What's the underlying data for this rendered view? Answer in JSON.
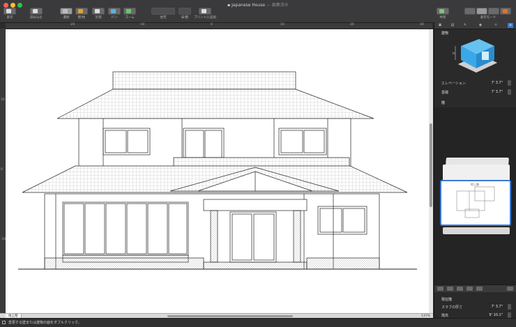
{
  "window": {
    "title": "Japanese House",
    "subtitle": "— 編集済み"
  },
  "toolbar": {
    "view_label": "表示",
    "import_label": "読み込む",
    "select_label": "選択",
    "wall_label": "壁/柱",
    "measure_label": "計測",
    "pan_label": "パン",
    "zoom_label": "ズーム",
    "home_label": "住宅",
    "floor_label": "床/壁",
    "print_label": "プリントに追加",
    "share_label": "共有",
    "display_mode_label": "表示モード"
  },
  "ruler": {
    "top_ticks": [
      "-20",
      "-10",
      "0",
      "10",
      "20",
      "30"
    ],
    "left_ticks": [
      "10",
      "0",
      "-10"
    ]
  },
  "canvas": {
    "layer_tab": "地上階",
    "zoom": "137%"
  },
  "status": {
    "message": "変更する壁または建物の面をダブルクリック。"
  },
  "panel": {
    "building_heading": "建物",
    "elevation_label": "エレベーション",
    "elevation_value": "7' 3.7\"",
    "foundation_label": "基礎",
    "foundation_value": "7' 3.7\"",
    "floor_heading": "階",
    "floor_card_label": "地上階",
    "current_floor_heading": "現在階",
    "slab_thickness_label": "スラブの厚さ",
    "slab_thickness_value": "7' 3.7\"",
    "height_label": "階高",
    "height_value": "9' 10.1\""
  },
  "icons": [
    "sidebar-toggle-icon",
    "import-icon",
    "select-icon",
    "wall-icon",
    "measure-icon",
    "pan-icon",
    "zoom-icon",
    "share-icon",
    "view-mode-icon",
    "building-3d-icon",
    "list-icon",
    "trash-icon"
  ],
  "colors": {
    "accent": "#3a7bd5",
    "background": "#2b2b2b",
    "canvas": "#ffffff",
    "building_3d": "#3aa8e8"
  }
}
